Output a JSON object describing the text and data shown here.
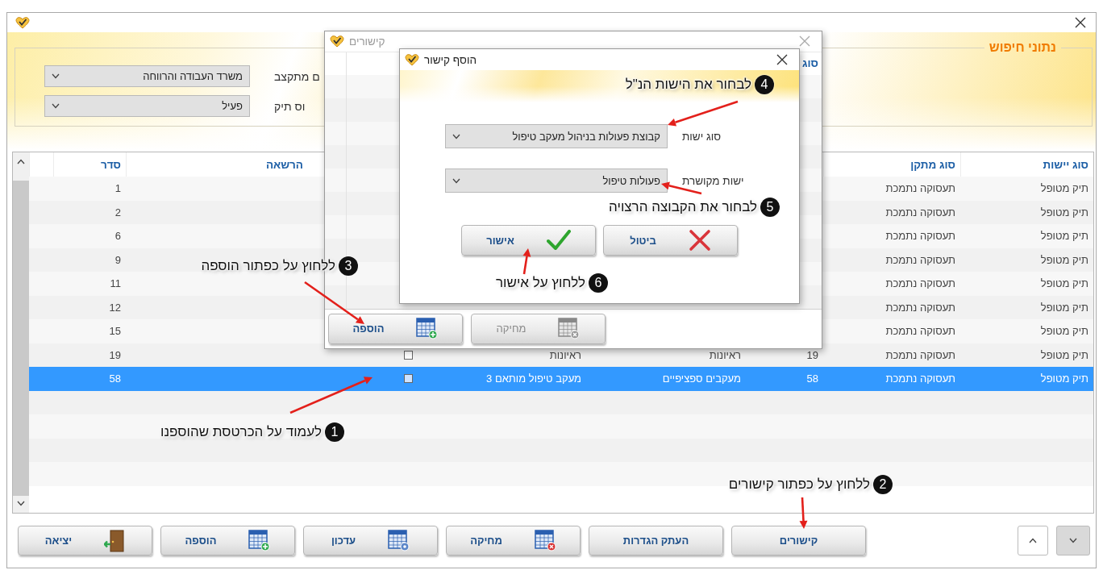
{
  "search_panel": {
    "title": "נתוני חיפוש",
    "fields": [
      {
        "label": "ם מתקצב",
        "value": "משרד העבודה והרווחה"
      },
      {
        "label": "וס תיק",
        "value": "פעיל"
      }
    ]
  },
  "table": {
    "columns": {
      "entity_type": "סוג יישות",
      "facility_type": "סוג מתקן",
      "permission": "הרשאה",
      "order": "סדר"
    },
    "rows": [
      {
        "entity_type": "תיק מטופל",
        "facility_type": "תעסוקה נתמכת",
        "order": "1",
        "selected": false
      },
      {
        "entity_type": "תיק מטופל",
        "facility_type": "תעסוקה נתמכת",
        "order": "2",
        "selected": false
      },
      {
        "entity_type": "תיק מטופל",
        "facility_type": "תעסוקה נתמכת",
        "order": "6",
        "selected": false
      },
      {
        "entity_type": "תיק מטופל",
        "facility_type": "תעסוקה נתמכת",
        "order": "9",
        "selected": false
      },
      {
        "entity_type": "תיק מטופל",
        "facility_type": "תעסוקה נתמכת",
        "order": "11",
        "selected": false
      },
      {
        "entity_type": "תיק מטופל",
        "facility_type": "תעסוקה נתמכת",
        "order": "12",
        "selected": false
      },
      {
        "entity_type": "תיק מטופל",
        "facility_type": "תעסוקה נתמכת",
        "order": "15",
        "selected": false
      },
      {
        "entity_type": "תיק מטופל",
        "facility_type": "תעסוקה נתמכת",
        "column_3": "19",
        "column_4": "ראיונות",
        "column_5": "ראיונות",
        "checked": false,
        "order": "19",
        "selected": false
      },
      {
        "entity_type": "תיק מטופל",
        "facility_type": "תעסוקה נתמכת",
        "column_3": "58",
        "column_4": "מעקבים ספציפיים",
        "column_5": "מעקב טיפול מותאם 3",
        "checked": false,
        "order": "58",
        "selected": true
      }
    ]
  },
  "buttons": [
    {
      "label": "קישורים",
      "kind": "plain"
    },
    {
      "label": "העתק הגדרות",
      "kind": "plain"
    },
    {
      "label": "מחיקה",
      "kind": "delete"
    },
    {
      "label": "עדכון",
      "kind": "update"
    },
    {
      "label": "הוספה",
      "kind": "add"
    },
    {
      "label": "יציאה",
      "kind": "exit"
    }
  ],
  "links_dialog": {
    "title": "קישורים",
    "column_header": "סוג",
    "buttons": [
      {
        "label": "מחיקה",
        "kind": "delete",
        "disabled": true
      },
      {
        "label": "הוספה",
        "kind": "add",
        "disabled": false
      }
    ]
  },
  "add_link_dialog": {
    "title": "הוסף קישור",
    "fields": [
      {
        "label": "סוג ישות",
        "value": "קבוצת פעולות בניהול מעקב טיפול"
      },
      {
        "label": "ישות מקושרת",
        "value": "פעולות טיפול"
      }
    ],
    "buttons": [
      {
        "label": "ביטול",
        "kind": "cancel"
      },
      {
        "label": "אישור",
        "kind": "ok"
      }
    ]
  },
  "annotations": [
    {
      "number": "1",
      "text": "לעמוד על הכרטסת שהוספנו"
    },
    {
      "number": "2",
      "text": "ללחוץ על כפתור קישורים"
    },
    {
      "number": "3",
      "text": "ללחוץ על כפתור הוספה"
    },
    {
      "number": "4",
      "text": "לבחור את הישות הנ\"ל"
    },
    {
      "number": "5",
      "text": "לבחור את הקבוצה הרצויה"
    },
    {
      "number": "6",
      "text": "ללחוץ על אישור"
    }
  ]
}
